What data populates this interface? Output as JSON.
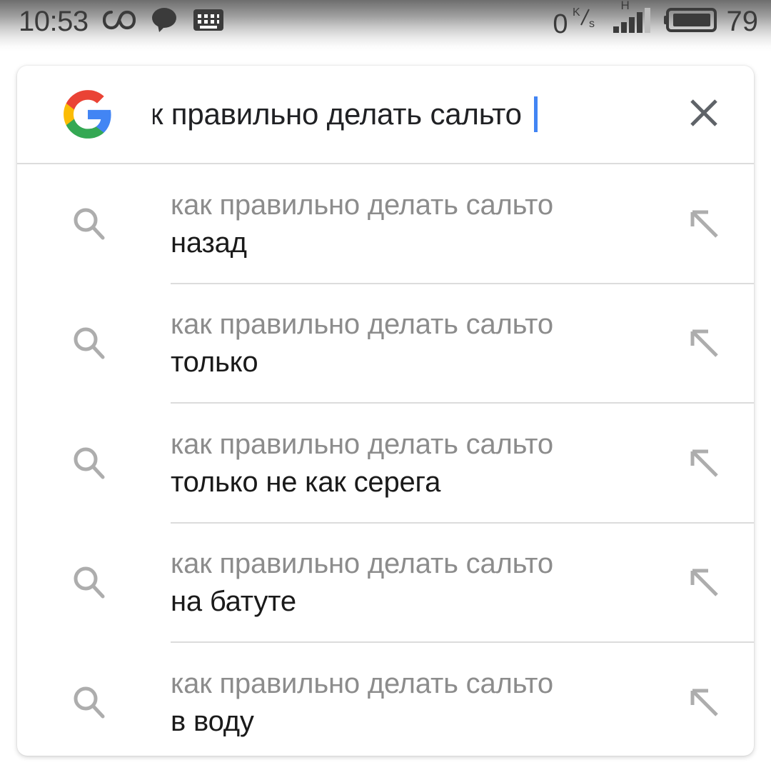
{
  "status_bar": {
    "clock": "10:53",
    "icons_left": [
      "infinity-icon",
      "chat-bubble-icon",
      "keyboard-icon"
    ],
    "network_speed_value": "0",
    "network_speed_unit_top": "K",
    "network_speed_unit_bottom": "s",
    "network_speed_separator": "/",
    "signal_type": "H",
    "signal_bars_total": 5,
    "signal_bars_active": 4,
    "battery_percent": "79"
  },
  "search": {
    "logo": "google-g-logo",
    "value": "ак правильно делать сальто",
    "full_query": "как правильно делать сальто",
    "clear_label": "×",
    "caret_color": "#4285f4"
  },
  "suggestions": [
    {
      "prefix": "как правильно делать сальто",
      "completion": "назад"
    },
    {
      "prefix": "как правильно делать сальто",
      "completion": "только"
    },
    {
      "prefix": "как правильно делать сальто",
      "completion": "только не как серега"
    },
    {
      "prefix": "как правильно делать сальто",
      "completion": "на батуте"
    },
    {
      "prefix": "как правильно делать сальто",
      "completion": "в воду"
    }
  ],
  "colors": {
    "prefix_gray": "#8c8c8c",
    "completion_black": "#1a1a1a",
    "divider": "#dcdcdc",
    "caret_blue": "#4285f4",
    "google_blue": "#4285f4",
    "google_red": "#ea4335",
    "google_yellow": "#fbbc05",
    "google_green": "#34a853"
  }
}
